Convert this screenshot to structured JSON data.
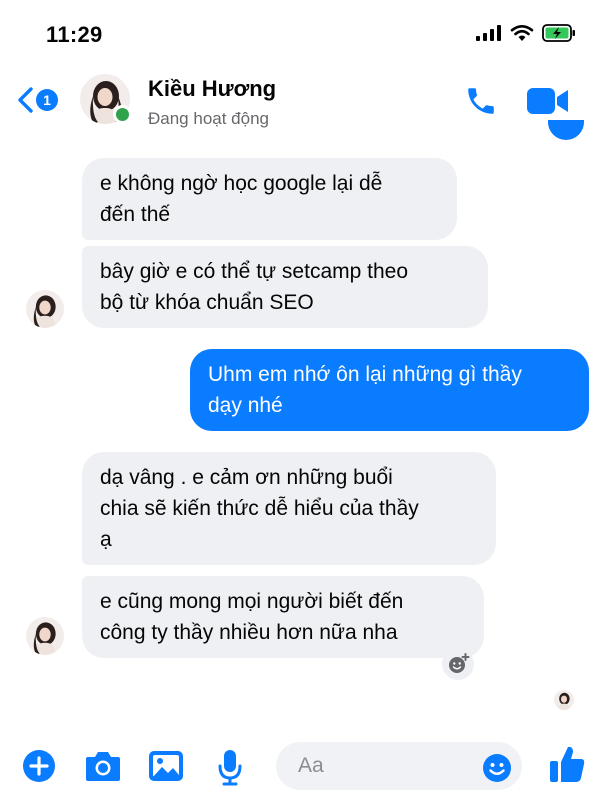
{
  "status_bar": {
    "time": "11:29"
  },
  "header": {
    "back_badge": "1",
    "contact_name": "Kiều Hương",
    "contact_status": "Đang hoạt động"
  },
  "messages": [
    {
      "sender": "contact",
      "lines": [
        "e không ngờ học google lại dễ",
        "đến thế"
      ]
    },
    {
      "sender": "contact",
      "lines": [
        "bây giờ e có thể tự setcamp theo",
        "bộ từ khóa chuẩn SEO"
      ]
    },
    {
      "sender": "me",
      "lines": [
        "Uhm em nhớ ôn lại những gì thầy",
        "dạy nhé"
      ]
    },
    {
      "sender": "contact",
      "lines": [
        "dạ vâng . e cảm ơn những buổi",
        "chia sẽ kiến thức dễ hiểu của thầy",
        "ạ"
      ]
    },
    {
      "sender": "contact",
      "lines": [
        "e cũng mong mọi người biết đến",
        "công ty thầy nhiều hơn nữa nha"
      ]
    }
  ],
  "composer": {
    "placeholder": "Aa"
  },
  "colors": {
    "accent": "#0a7cff",
    "incoming_bubble": "#eff0f3",
    "online": "#31a24c",
    "battery": "#34c759"
  },
  "icons": [
    "back-chevron-icon",
    "phone-icon",
    "video-camera-icon",
    "plus-icon",
    "camera-icon",
    "gallery-icon",
    "microphone-icon",
    "emoji-icon",
    "like-thumb-icon",
    "add-reaction-icon"
  ]
}
